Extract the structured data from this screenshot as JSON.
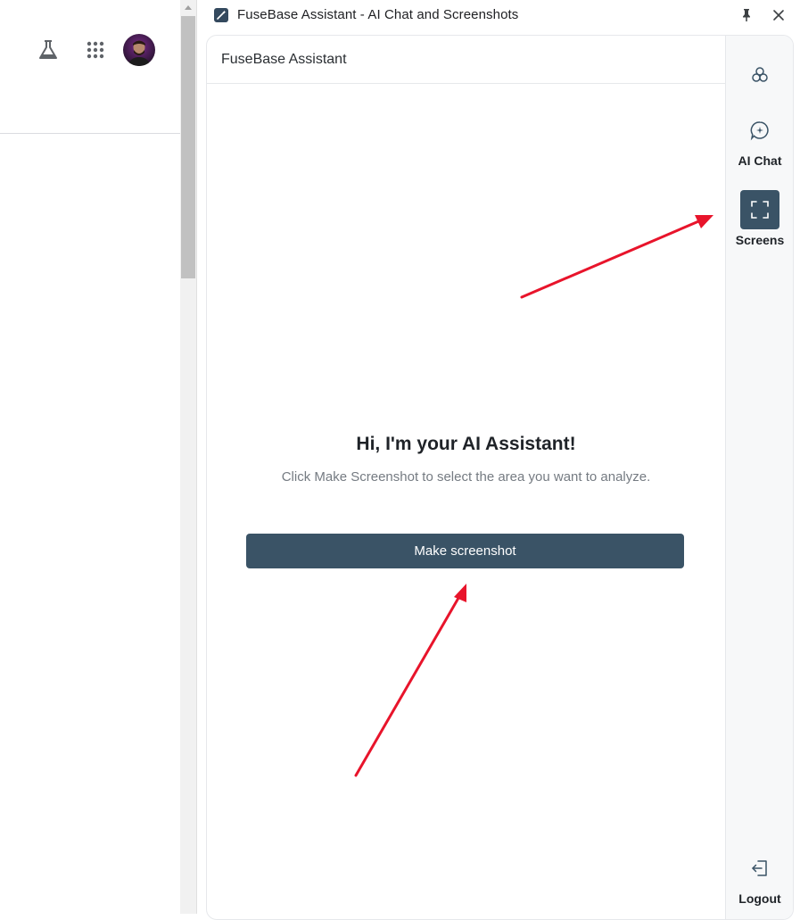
{
  "window": {
    "title": "FuseBase Assistant - AI Chat and Screenshots"
  },
  "panel": {
    "header_title": "FuseBase Assistant",
    "greeting": "Hi, I'm your AI Assistant!",
    "instruction": "Click Make Screenshot to select the area you want to analyze.",
    "make_screenshot_label": "Make screenshot"
  },
  "side_nav": {
    "items": [
      {
        "icon": "apps-cluster-icon",
        "label": ""
      },
      {
        "icon": "ai-chat-bubble-icon",
        "label": "AI Chat"
      },
      {
        "icon": "screenshot-frame-icon",
        "label": "Screens",
        "active": true
      },
      {
        "icon": "logout-icon",
        "label": "Logout"
      }
    ]
  },
  "browser_toolbar": {
    "icons": [
      "labs-flask-icon",
      "google-apps-icon",
      "account-avatar"
    ]
  },
  "colors": {
    "accent": "#3a5366",
    "annotation_arrow": "#e8142b",
    "text_muted": "#757b82"
  }
}
